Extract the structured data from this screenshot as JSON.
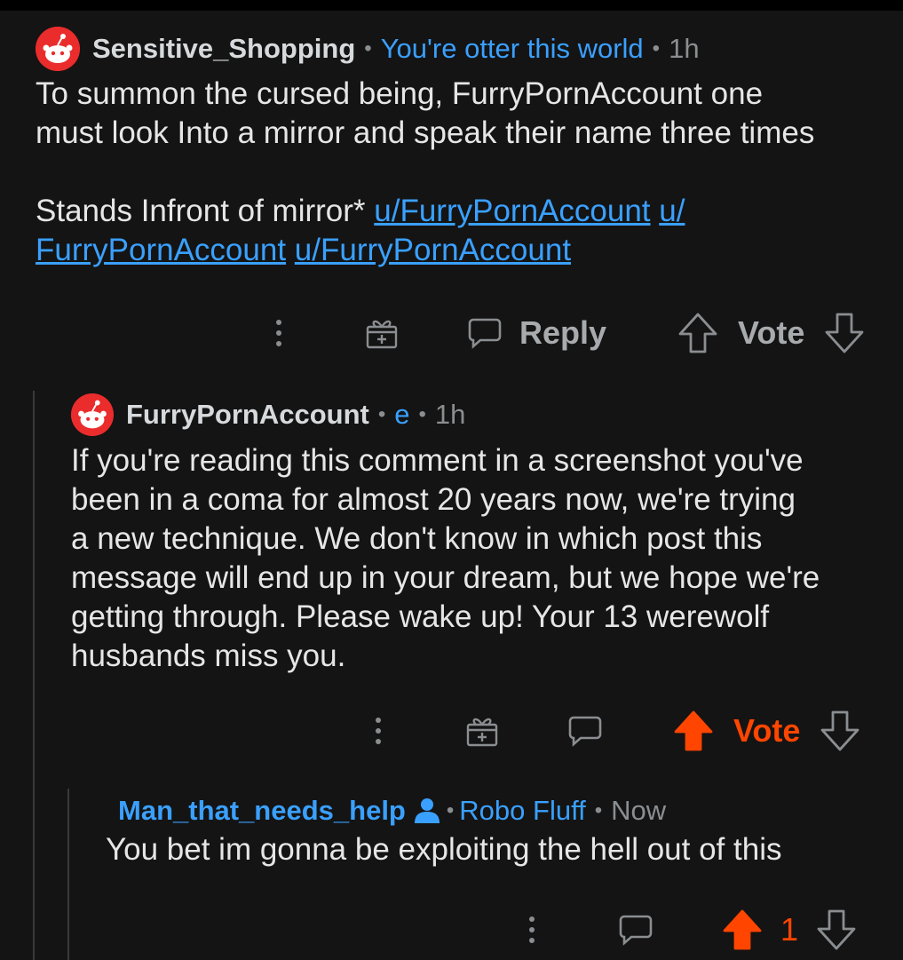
{
  "comments": [
    {
      "username": "Sensitive_Shopping",
      "flair": "You're otter this world",
      "time": "1h",
      "body_line1": "To summon the cursed  being, FurryPornAccount one",
      "body_line2": "must look Into a mirror and speak their name three times",
      "body_line3_prefix": "Stands Infront of mirror* ",
      "mention1": "u/FurryPornAccount",
      "mention2_a": "u/",
      "mention2_b": "FurryPornAccount",
      "mention3": "u/FurryPornAccount",
      "reply_label": "Reply",
      "vote_label": "Vote"
    },
    {
      "username": "FurryPornAccount",
      "flair": "e",
      "time": "1h",
      "body_lines": [
        "If you're reading this comment in a screenshot you've",
        "been in a coma for almost 20 years now, we're trying",
        "a new technique. We don't know in which post this",
        "message will end up in  your dream, but we hope we're",
        "getting through. Please wake up! Your 13 werewolf",
        "husbands miss you."
      ],
      "vote_label": "Vote",
      "upvoted": true
    },
    {
      "username": "Man_that_needs_help",
      "flair": "Robo Fluff",
      "time": "Now",
      "body": "You bet im gonna be exploiting the hell out of this",
      "score": "1",
      "upvoted": true
    }
  ],
  "separator": "•",
  "colors": {
    "accent_blue": "#3aa0ff",
    "upvote_orange": "#ff4500",
    "background": "#141414"
  }
}
